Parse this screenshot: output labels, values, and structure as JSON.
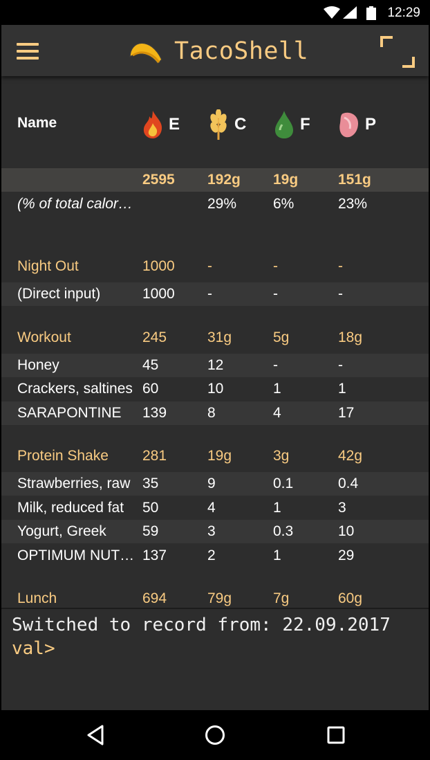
{
  "status_bar": {
    "time": "12:29"
  },
  "app": {
    "title": "TacoShell"
  },
  "table": {
    "name_header": "Name",
    "columns": [
      {
        "label": "E",
        "icon": "fire-icon"
      },
      {
        "label": "C",
        "icon": "wheat-icon"
      },
      {
        "label": "F",
        "icon": "oil-drop-icon"
      },
      {
        "label": "P",
        "icon": "meat-icon"
      }
    ],
    "totals": [
      "",
      "2595",
      "192g",
      "19g",
      "151g"
    ],
    "percent": [
      "(% of total calories)",
      "",
      "29%",
      "6%",
      "23%"
    ],
    "groups": [
      {
        "name": "Night Out",
        "values": [
          "1000",
          "-",
          "-",
          "-"
        ],
        "items": [
          {
            "name": "(Direct input)",
            "values": [
              "1000",
              "-",
              "-",
              "-"
            ]
          }
        ]
      },
      {
        "name": "Workout",
        "values": [
          "245",
          "31g",
          "5g",
          "18g"
        ],
        "items": [
          {
            "name": "Honey",
            "values": [
              "45",
              "12",
              "-",
              "-"
            ]
          },
          {
            "name": "Crackers, saltines",
            "values": [
              "60",
              "10",
              "1",
              "1"
            ]
          },
          {
            "name": "SARAPONTINE",
            "values": [
              "139",
              "8",
              "4",
              "17"
            ]
          }
        ]
      },
      {
        "name": "Protein Shake",
        "values": [
          "281",
          "19g",
          "3g",
          "42g"
        ],
        "items": [
          {
            "name": "Strawberries, raw",
            "values": [
              "35",
              "9",
              "0.1",
              "0.4"
            ]
          },
          {
            "name": "Milk, reduced fat",
            "values": [
              "50",
              "4",
              "1",
              "3"
            ]
          },
          {
            "name": "Yogurt, Greek",
            "values": [
              "59",
              "3",
              "0.3",
              "10"
            ]
          },
          {
            "name": "OPTIMUM NUTRITION",
            "values": [
              "137",
              "2",
              "1",
              "29"
            ]
          }
        ]
      },
      {
        "name": "Lunch",
        "values": [
          "694",
          "79g",
          "7g",
          "60g"
        ],
        "items": []
      }
    ]
  },
  "console": {
    "output": "Switched to record from: 22.09.2017",
    "prompt": "val>"
  },
  "colors": {
    "accent": "#f9cb82",
    "background": "#2d2d2d",
    "toolbar": "#333333"
  }
}
